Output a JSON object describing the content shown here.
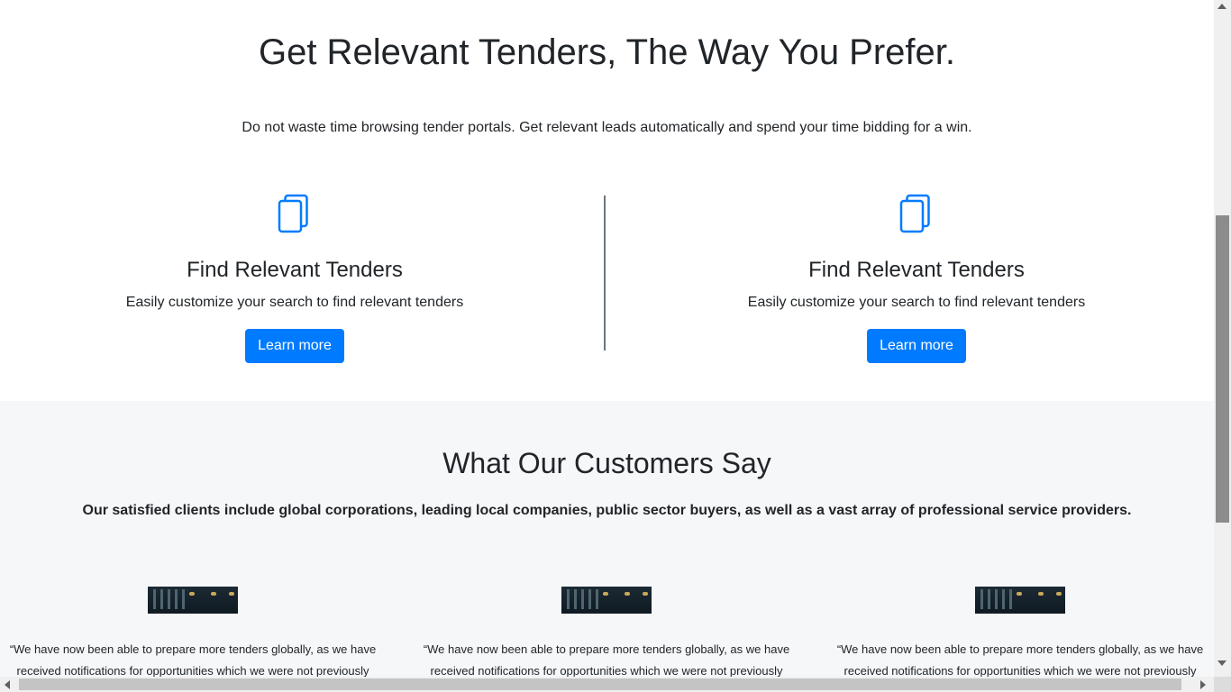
{
  "hero": {
    "title": "Get Relevant Tenders, The Way You Prefer.",
    "lead": "Do not waste time browsing tender portals. Get relevant leads automatically and spend your time bidding for a win."
  },
  "features": [
    {
      "icon": "documents-icon",
      "title": "Find Relevant Tenders",
      "text": "Easily customize your search to find relevant tenders",
      "button": "Learn more"
    },
    {
      "icon": "documents-icon",
      "title": "Find Relevant Tenders",
      "text": "Easily customize your search to find relevant tenders",
      "button": "Learn more"
    }
  ],
  "testimonials": {
    "title": "What Our Customers Say",
    "subtitle": "Our satisfied clients include global corporations, leading local companies, public sector buyers, as well as a vast array of professional service providers.",
    "cards": [
      {
        "quote": "“We have now been able to prepare more tenders globally, as we have received notifications for opportunities which we were not previously"
      },
      {
        "quote": "“We have now been able to prepare more tenders globally, as we have received notifications for opportunities which we were not previously"
      },
      {
        "quote": "“We have now been able to prepare more tenders globally, as we have received notifications for opportunities which we were not previously"
      }
    ]
  },
  "colors": {
    "primary": "#007bff",
    "divider": "#6c757d",
    "section_bg": "#f6f7f9",
    "text": "#212529"
  }
}
